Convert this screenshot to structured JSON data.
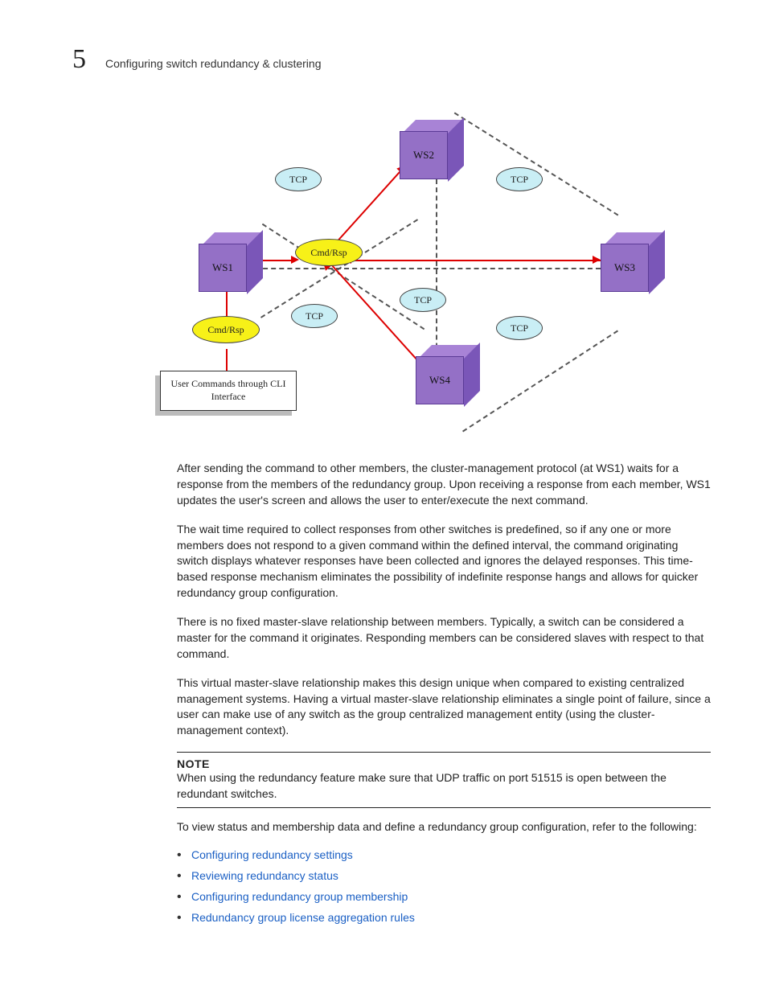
{
  "header": {
    "chapter": "5",
    "title": "Configuring switch redundancy & clustering"
  },
  "diagram": {
    "nodes": {
      "ws1": "WS1",
      "ws2": "WS2",
      "ws3": "WS3",
      "ws4": "WS4"
    },
    "labels": {
      "tcp": "TCP",
      "cmdrsp": "Cmd/Rsp"
    },
    "cli_box": "User Commands through CLI Interface"
  },
  "paragraphs": {
    "p1": "After sending the command to other members, the cluster-management protocol (at WS1) waits for a response from the members of the redundancy group. Upon receiving a response from each member, WS1 updates the user's screen and allows the user to enter/execute the next command.",
    "p2": "The wait time required to collect responses from other switches is predefined, so if any one or more members does not respond to a given command within the defined interval, the command originating switch displays whatever responses have been collected and ignores the delayed responses. This time-based response mechanism eliminates the possibility of indefinite response hangs and allows for quicker redundancy group configuration.",
    "p3": "There is no fixed master-slave relationship between members. Typically, a switch can be considered a master for the command it originates. Responding members can be considered slaves with respect to that command.",
    "p4": "This virtual master-slave relationship makes this design unique when compared to existing centralized management systems. Having a virtual master-slave relationship eliminates a single point of failure, since a user can make use of any switch as the group centralized management entity (using the cluster-management context)."
  },
  "note": {
    "label": "NOTE",
    "text": "When using the redundancy feature make sure that UDP traffic on port 51515 is open between the redundant switches."
  },
  "followup": "To view status and membership data and define a redundancy group configuration, refer to the following:",
  "links": [
    "Configuring redundancy settings",
    "Reviewing redundancy status",
    "Configuring redundancy group membership",
    "Redundancy group license aggregation rules"
  ]
}
